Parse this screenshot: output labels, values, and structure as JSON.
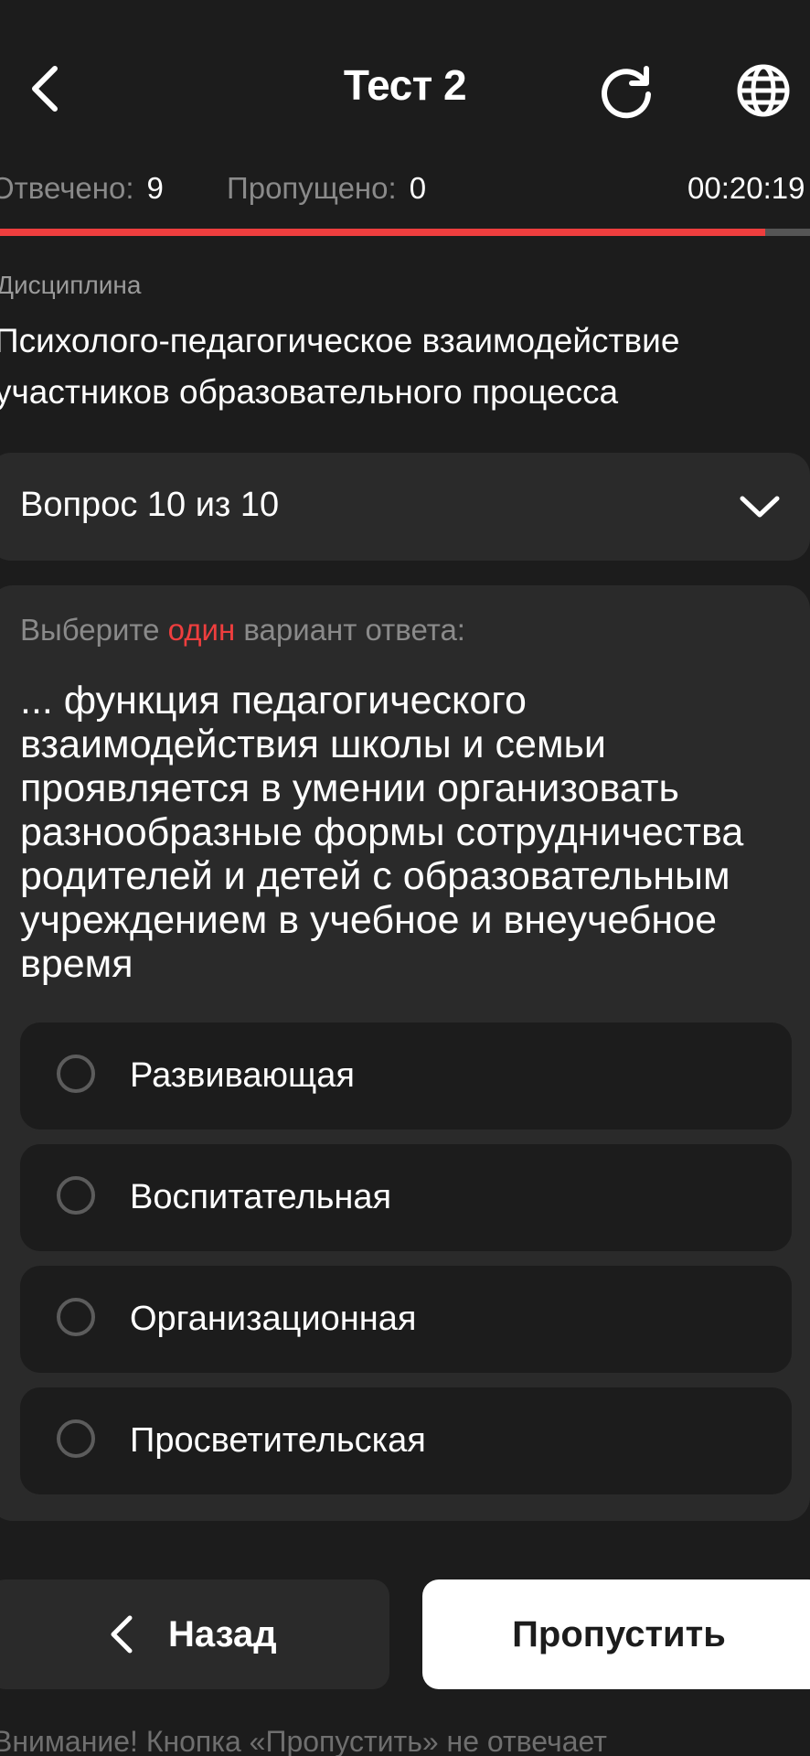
{
  "header": {
    "title": "Тест 2",
    "back_icon": "chevron-left-icon",
    "refresh_icon": "refresh-icon",
    "language_icon": "globe-icon"
  },
  "stats": {
    "answered_label": "Отвечено:",
    "answered_value": "9",
    "skipped_label": "Пропущено:",
    "skipped_value": "0",
    "timer": "00:20:19"
  },
  "progress": {
    "fraction": 0.945,
    "fill_color": "#ee3e3e",
    "track_color": "#555555"
  },
  "discipline": {
    "label": "Дисциплина",
    "name": "Психолого-педагогическое взаимодействие участников образовательного процесса"
  },
  "question_selector": {
    "label": "Вопрос 10 из 10",
    "icon": "chevron-down-icon"
  },
  "question": {
    "instruction_before": "Выберите ",
    "instruction_accent": "один",
    "instruction_after": " вариант ответа:",
    "text": "... функция педагогического взаимодействия школы и семьи проявляется в умении организовать разнообразные формы сотрудничества родителей и детей с образовательным учреждением в учебное и внеучебное время",
    "options": [
      {
        "label": "Развивающая"
      },
      {
        "label": "Воспитательная"
      },
      {
        "label": "Организационная"
      },
      {
        "label": "Просветительская"
      }
    ]
  },
  "buttons": {
    "back_label": "Назад",
    "skip_label": "Пропустить"
  },
  "warning": "Внимание! Кнопка «Пропустить» не отвечает",
  "colors": {
    "background": "#1c1c1c",
    "card": "#2a2a2a",
    "accent": "#ee3e3e"
  }
}
